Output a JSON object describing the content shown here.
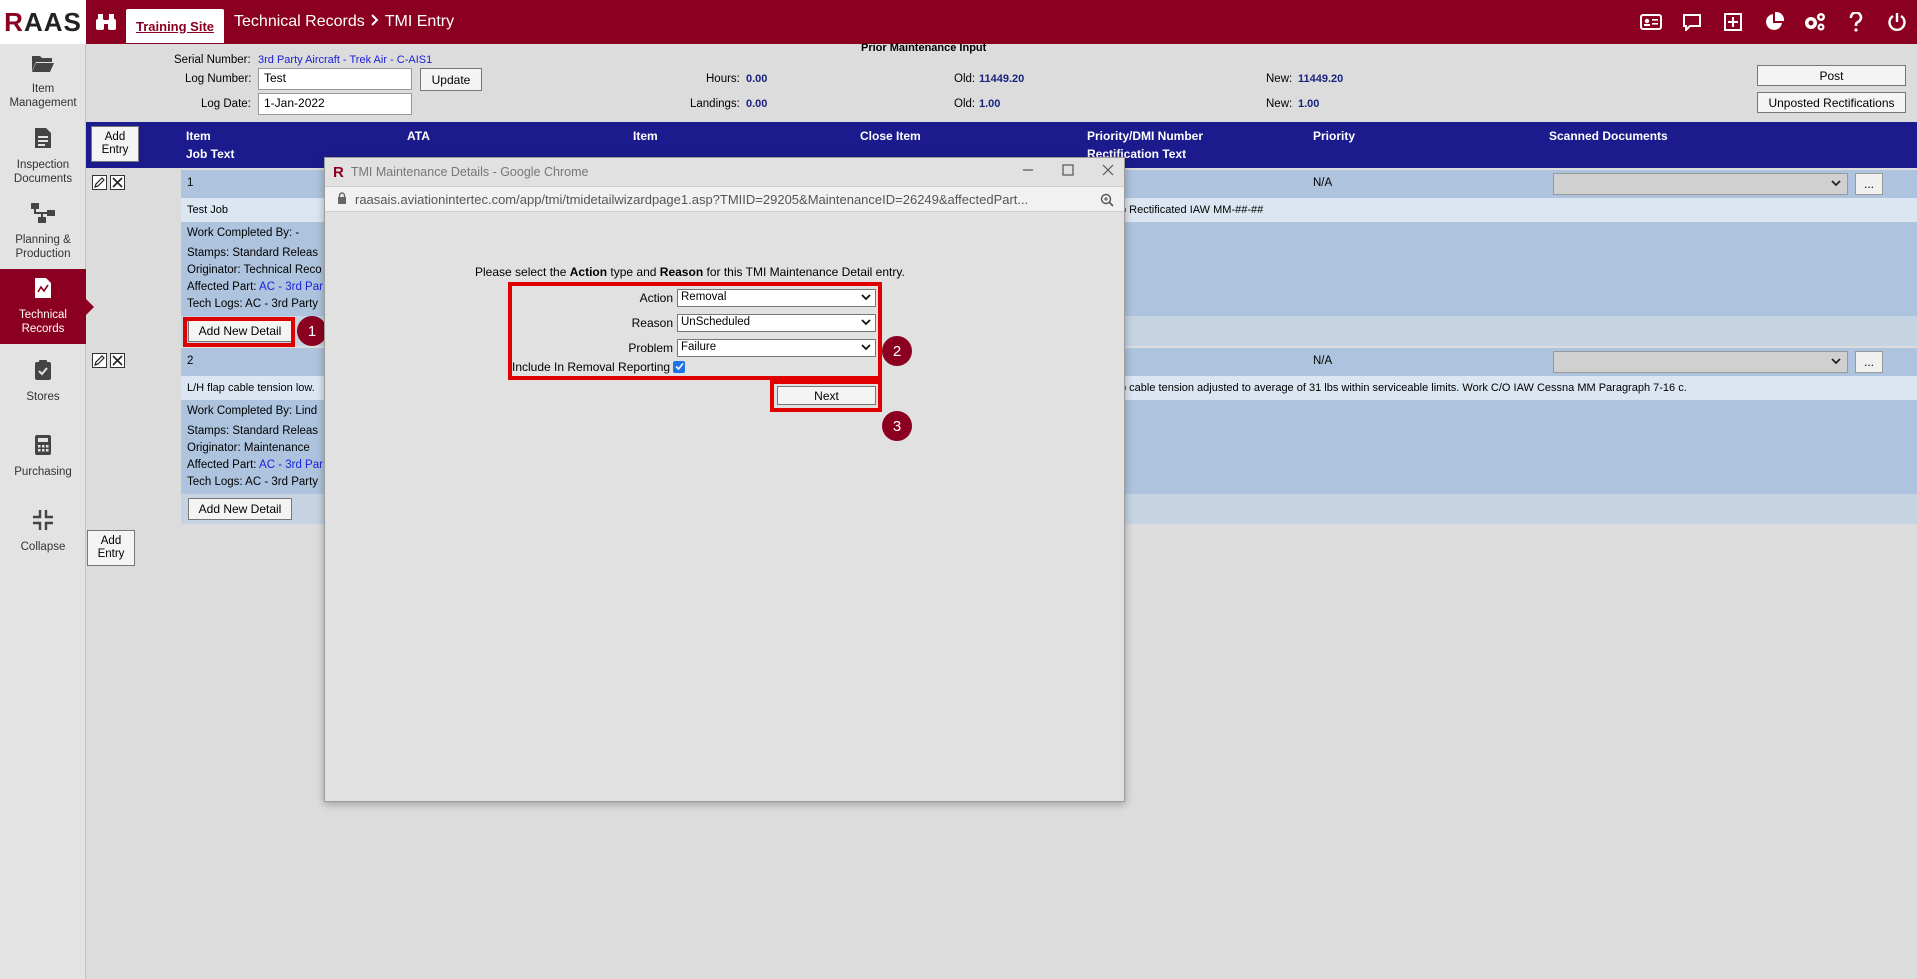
{
  "app": {
    "logo_first": "R",
    "logo_rest": "AAS",
    "site_tab": "Training Site",
    "breadcrumb": [
      "Technical Records",
      "TMI Entry"
    ],
    "brand_color": "#8b0020"
  },
  "top_icons": [
    "id-card-icon",
    "chat-icon",
    "plus-square-icon",
    "pie-chart-icon",
    "gears-icon",
    "help-icon",
    "power-icon"
  ],
  "sidebar": {
    "items": [
      {
        "label": "Item Management",
        "icon": "folder-icon"
      },
      {
        "label": "Inspection Documents",
        "icon": "document-icon"
      },
      {
        "label": "Planning & Production",
        "icon": "flow-icon"
      },
      {
        "label": "Technical Records",
        "icon": "records-icon",
        "active": true
      },
      {
        "label": "Stores",
        "icon": "clipboard-check-icon"
      },
      {
        "label": "Purchasing",
        "icon": "calculator-icon"
      },
      {
        "label": "Collapse",
        "icon": "collapse-icon"
      }
    ]
  },
  "header": {
    "section_title": "Prior Maintenance Input",
    "serial_label": "Serial Number:",
    "serial_value": "3rd Party Aircraft - Trek Air - C-AIS1",
    "log_number_label": "Log Number:",
    "log_number_value": "Test",
    "update_button": "Update",
    "log_date_label": "Log Date:",
    "log_date_value": "1-Jan-2022",
    "hours_label": "Hours:",
    "hours_value": "0.00",
    "landings_label": "Landings:",
    "landings_value": "0.00",
    "old_label": "Old:",
    "old_hours": "11449.20",
    "old_landings": "1.00",
    "new_label": "New:",
    "new_hours": "11449.20",
    "new_landings": "1.00",
    "post_button": "Post",
    "unposted_button": "Unposted Rectifications"
  },
  "table": {
    "add_entry": "Add Entry",
    "columns": {
      "item": "Item",
      "job_text": "Job Text",
      "ata": "ATA",
      "item2": "Item",
      "close_item": "Close Item",
      "priority_dmi": "Priority/DMI Number",
      "rect_text": "Rectification Text",
      "priority": "Priority",
      "scanned": "Scanned Documents"
    },
    "dots": "...",
    "rows": [
      {
        "number": "1",
        "priority": "N/A",
        "job_text": "Test Job",
        "rect_text": "b Rectificated IAW MM-##-##",
        "work_completed": "Work Completed By: -",
        "stamps": "Stamps: Standard Releas",
        "originator": "Originator: Technical Reco",
        "affected_label": "Affected Part: ",
        "affected_link": "AC - 3rd Par",
        "tech_logs": "Tech Logs: AC - 3rd Party",
        "add_detail": "Add New Detail"
      },
      {
        "number": "2",
        "priority": "N/A",
        "job_text": "L/H flap cable tension low.",
        "rect_text": "p cable tension adjusted to average of 31 lbs within serviceable limits. Work C/O IAW Cessna MM Paragraph 7-16 c.",
        "work_completed": "Work Completed By: Lind",
        "stamps": "Stamps: Standard Releas",
        "originator": "Originator: Maintenance",
        "affected_label": "Affected Part: ",
        "affected_link": "AC - 3rd Par",
        "tech_logs": "Tech Logs: AC - 3rd Party",
        "add_detail": "Add New Detail"
      }
    ]
  },
  "markers": [
    "1",
    "2",
    "3"
  ],
  "modal": {
    "title": "TMI Maintenance Details - Google Chrome",
    "url": "raasais.aviationintertec.com/app/tmi/tmidetailwizardpage1.asp?TMIID=29205&MaintenanceID=26249&affectedPart...",
    "instr_pre": "Please select the ",
    "instr_action": "Action",
    "instr_mid": " type and ",
    "instr_reason": "Reason",
    "instr_post": " for this TMI Maintenance Detail entry.",
    "action_label": "Action",
    "action_value": "Removal",
    "reason_label": "Reason",
    "reason_value": "UnScheduled",
    "problem_label": "Problem",
    "problem_value": "Failure",
    "include_label": "Include In Removal Reporting",
    "next_button": "Next"
  }
}
